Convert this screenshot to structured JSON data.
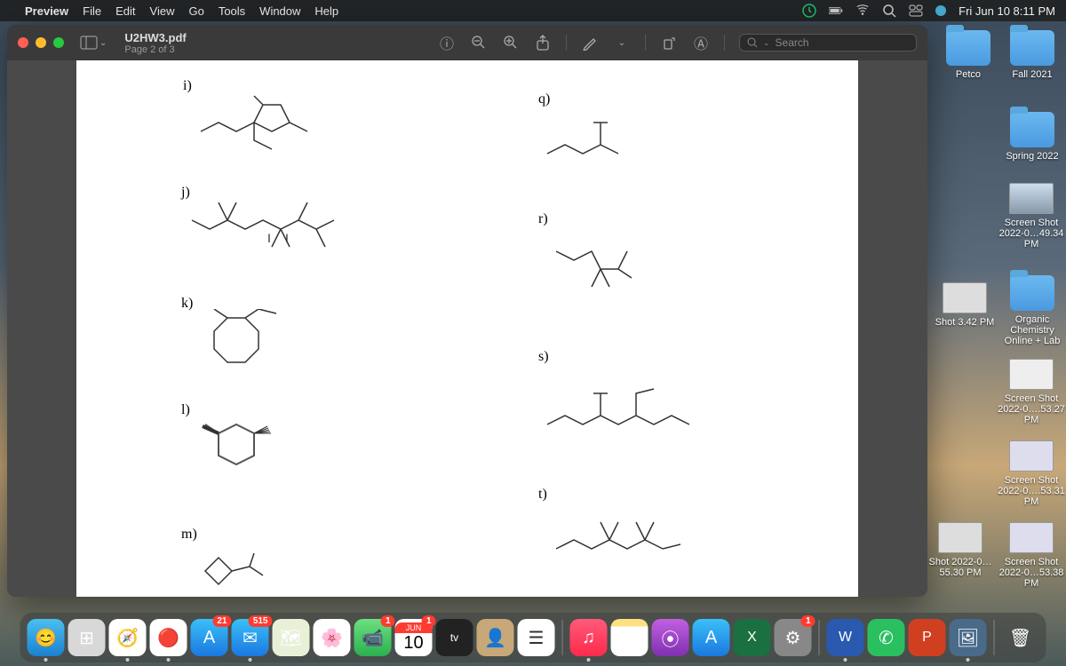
{
  "menubar": {
    "app": "Preview",
    "items": [
      "File",
      "Edit",
      "View",
      "Go",
      "Tools",
      "Window",
      "Help"
    ],
    "datetime": "Fri Jun 10  8:11 PM"
  },
  "window": {
    "title": "U2HW3.pdf",
    "subtitle": "Page 2 of 3",
    "search_placeholder": "Search"
  },
  "problems": {
    "i": "i)",
    "j": "j)",
    "k": "k)",
    "l": "l)",
    "m": "m)",
    "q": "q)",
    "r": "r)",
    "s": "s)",
    "t": "t)"
  },
  "desktop": {
    "petco": "Petco",
    "fall2021": "Fall 2021",
    "spring2022": "Spring 2022",
    "ss1": "Screen Shot 2022-0…49.34 PM",
    "shot342": "Shot 3.42 PM",
    "ochem": "Organic Chemistry Online + Lab",
    "ss2": "Screen Shot 2022-0….53.27 PM",
    "ss3": "Screen Shot 2022-0….53.31 PM",
    "shot5530": "Shot 2022-0…55.30 PM",
    "ss4": "Screen Shot 2022-0…53.38 PM"
  },
  "dock": {
    "mail_badge": "515",
    "appstore_badge": "21",
    "facetime_badge": "1",
    "cal_month": "JUN",
    "cal_day": "10",
    "cal_badge": "1",
    "sys_badge": "1"
  }
}
